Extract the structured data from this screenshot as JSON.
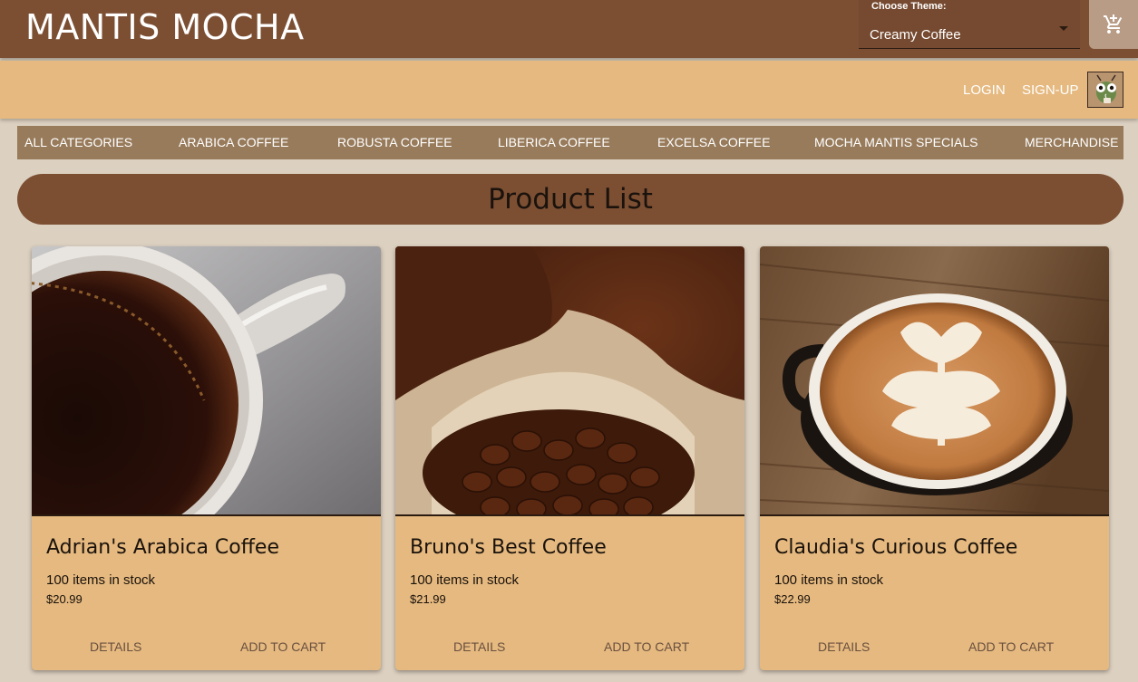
{
  "header": {
    "brand": "MANTIS MOCHA",
    "theme_label": "Choose Theme:",
    "theme_value": "Creamy Coffee",
    "cart_icon": "add-shopping-cart-icon"
  },
  "auth": {
    "login": "LOGIN",
    "signup": "SIGN-UP",
    "avatar_icon": "mantis-avatar"
  },
  "categories": [
    "ALL CATEGORIES",
    "ARABICA COFFEE",
    "ROBUSTA COFFEE",
    "LIBERICA COFFEE",
    "EXCELSA COFFEE",
    "MOCHA MANTIS SPECIALS",
    "MERCHANDISE"
  ],
  "page_title": "Product List",
  "products": [
    {
      "name": "Adrian's Arabica Coffee",
      "stock": "100 items in stock",
      "price": "$20.99",
      "details_label": "DETAILS",
      "add_label": "ADD TO CART"
    },
    {
      "name": "Bruno's Best Coffee",
      "stock": "100 items in stock",
      "price": "$21.99",
      "details_label": "DETAILS",
      "add_label": "ADD TO CART"
    },
    {
      "name": "Claudia's Curious Coffee",
      "stock": "100 items in stock",
      "price": "$22.99",
      "details_label": "DETAILS",
      "add_label": "ADD TO CART"
    }
  ],
  "colors": {
    "header": "#7c4f33",
    "subbar": "#e5b97f",
    "nav": "#987b5b",
    "background": "#dcd0c0",
    "card": "#e5b97f"
  }
}
